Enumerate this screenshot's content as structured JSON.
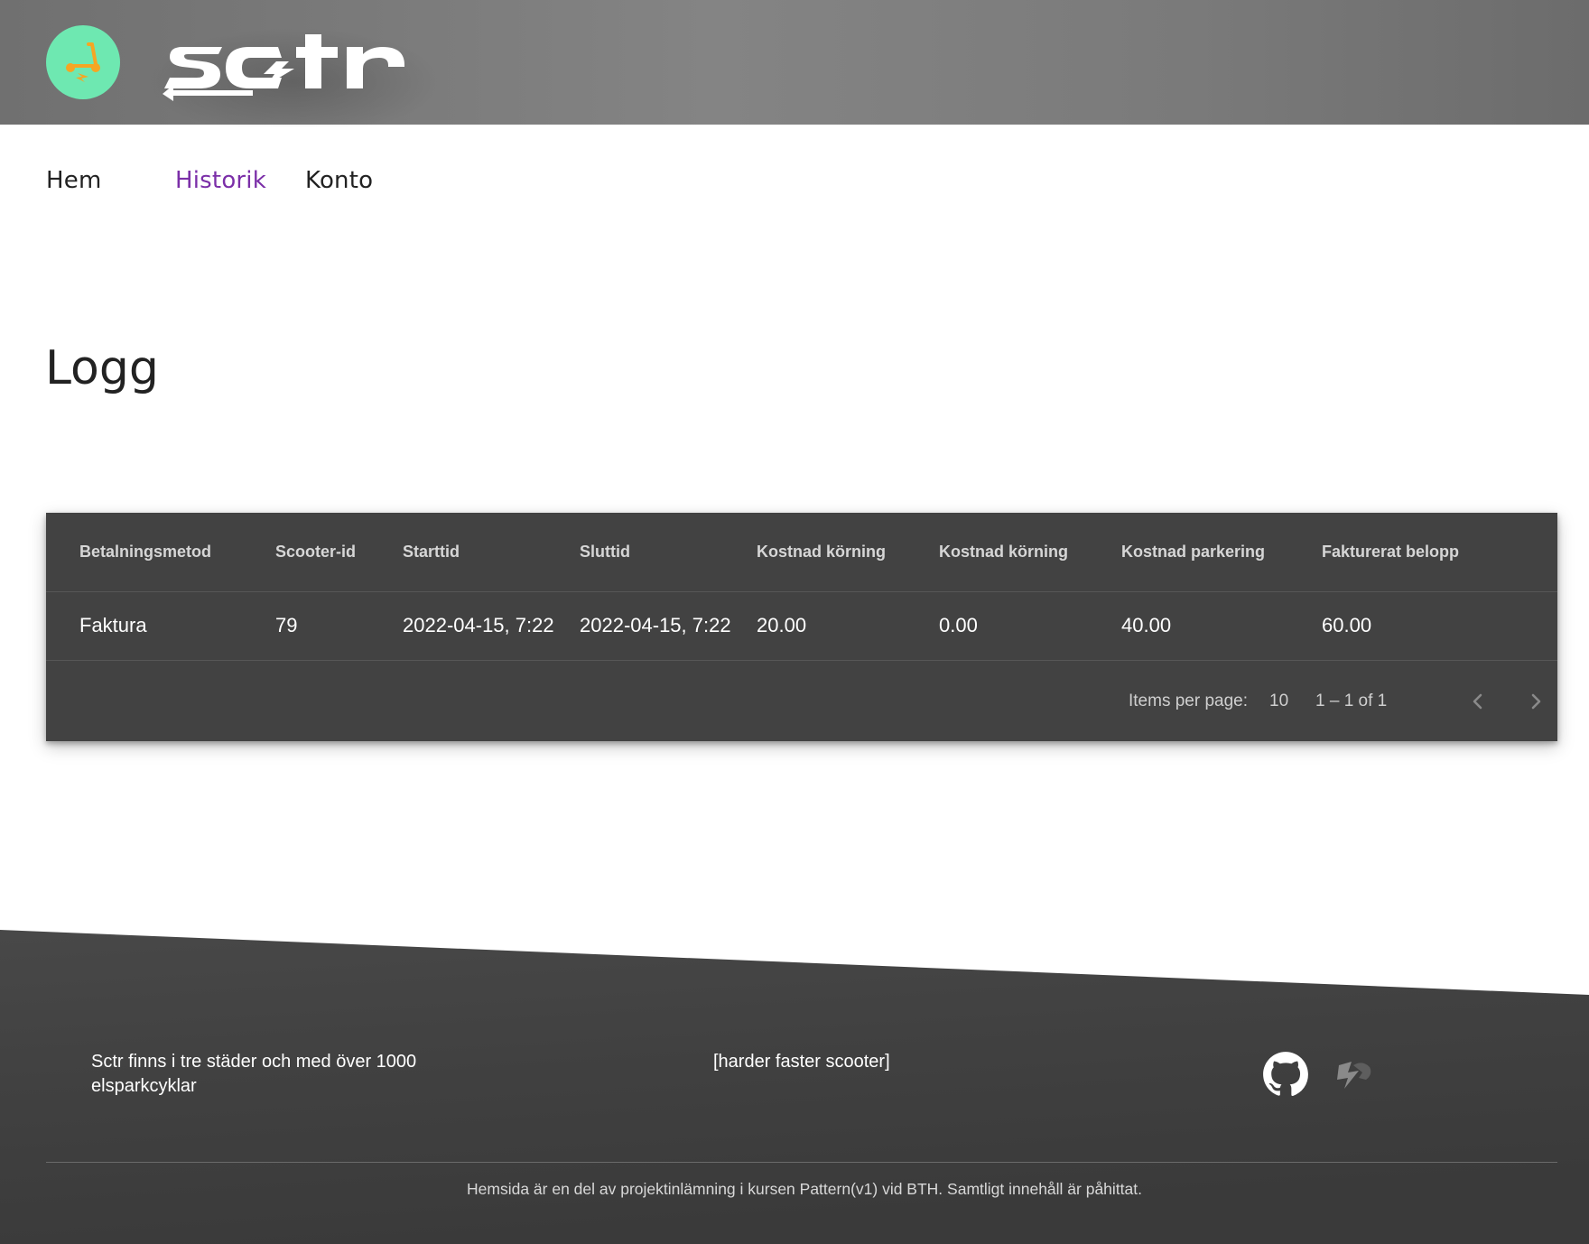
{
  "header": {
    "logo_icon": "scooter-icon",
    "brand_text": "sctr",
    "colors": {
      "header_bg": "#7f7f7f",
      "logo_circle": "#6ee8b1",
      "logo_glyph": "#f5a623"
    }
  },
  "nav": {
    "items": [
      {
        "label": "Hem",
        "active": false
      },
      {
        "label": "Historik",
        "active": true
      },
      {
        "label": "Konto",
        "active": false
      }
    ],
    "active_color": "#7b2fa8"
  },
  "main": {
    "title": "Logg",
    "table": {
      "columns": [
        "Betalningsmetod",
        "Scooter-id",
        "Starttid",
        "Sluttid",
        "Kostnad körning",
        "Kostnad körning",
        "Kostnad parkering",
        "Fakturerat belopp"
      ],
      "rows": [
        [
          "Faktura",
          "79",
          "2022-04-15, 7:22",
          "2022-04-15, 7:22",
          "20.00",
          "0.00",
          "40.00",
          "60.00"
        ]
      ],
      "paginator": {
        "items_per_page_label": "Items per page:",
        "items_per_page_value": "10",
        "range_label": "1 – 1 of 1",
        "prev_icon": "chevron-left-icon",
        "next_icon": "chevron-right-icon"
      },
      "colors": {
        "card_bg": "#424242",
        "header_text": "#d6d6d6"
      }
    }
  },
  "footer": {
    "description": "Sctr finns i tre städer och med över 1000 elsparkcyklar",
    "tagline": "[harder faster scooter]",
    "social": [
      {
        "icon": "github-icon"
      },
      {
        "icon": "sctr-logo-icon"
      }
    ],
    "copyright": "Hemsida är en del av projektinlämning i kursen Pattern(v1) vid BTH. Samtligt innehåll är påhittat.",
    "colors": {
      "bg": "#3f3f3f"
    }
  }
}
